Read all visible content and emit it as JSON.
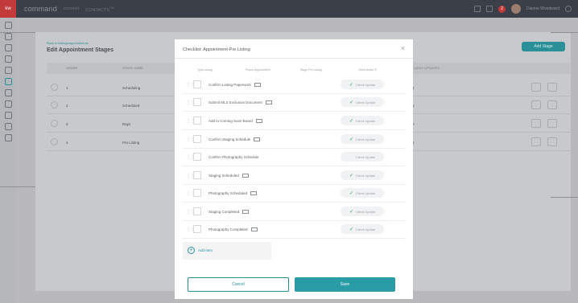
{
  "topbar": {
    "logo": "kw",
    "brand": "command",
    "nav1": "connect",
    "nav2": "CONTACTS",
    "nav2_sup": "TM",
    "badge": "2",
    "user": "Dianne Woodward"
  },
  "background": {
    "breadcrumb": "Back to listings/appointments",
    "title": "Edit Appointment Stages",
    "add_stage": "Add Stage",
    "headers": {
      "order": "ORDER",
      "stage_name": "STAGE NAME",
      "client_updates": "CLIENT UPDATES"
    },
    "rows": [
      {
        "order": "1",
        "name": "Scheduling",
        "count": "4"
      },
      {
        "order": "2",
        "name": "Scheduled",
        "count": "6"
      },
      {
        "order": "3",
        "name": "Days",
        "count": "0"
      },
      {
        "order": "4",
        "name": "Pre Listing",
        "count": "9"
      }
    ]
  },
  "modal": {
    "title": "Checklist: Appointment-Pre Listing",
    "close": "×",
    "columns": [
      "Type Listing",
      "Phone Appointment",
      "Stage Pre Listing",
      "Client Active ®"
    ],
    "items": [
      {
        "label": "Confirm Listing Paperwork",
        "mail": true,
        "update": "Client Update",
        "on": true
      },
      {
        "label": "Submit MLS Exclusion Document",
        "mail": true,
        "update": "Client Update",
        "on": true
      },
      {
        "label": "Add to Coming Soon Board",
        "mail": true,
        "update": "Client Update",
        "on": true
      },
      {
        "label": "Confirm Staging Schedule",
        "mail": true,
        "update": "Client Update",
        "on": true
      },
      {
        "label": "Confirm Photography Schedule",
        "mail": false,
        "update": "Client Update",
        "on": false
      },
      {
        "label": "Staging Scheduled",
        "mail": true,
        "update": "Client Update",
        "on": true
      },
      {
        "label": "Photography Scheduled",
        "mail": true,
        "update": "Client Update",
        "on": true
      },
      {
        "label": "Staging Completed",
        "mail": true,
        "update": "Client Update",
        "on": true
      },
      {
        "label": "Photography Completed",
        "mail": true,
        "update": "Client Update",
        "on": true
      }
    ],
    "add_item": "Add Item",
    "cancel": "Cancel",
    "save": "Save"
  }
}
